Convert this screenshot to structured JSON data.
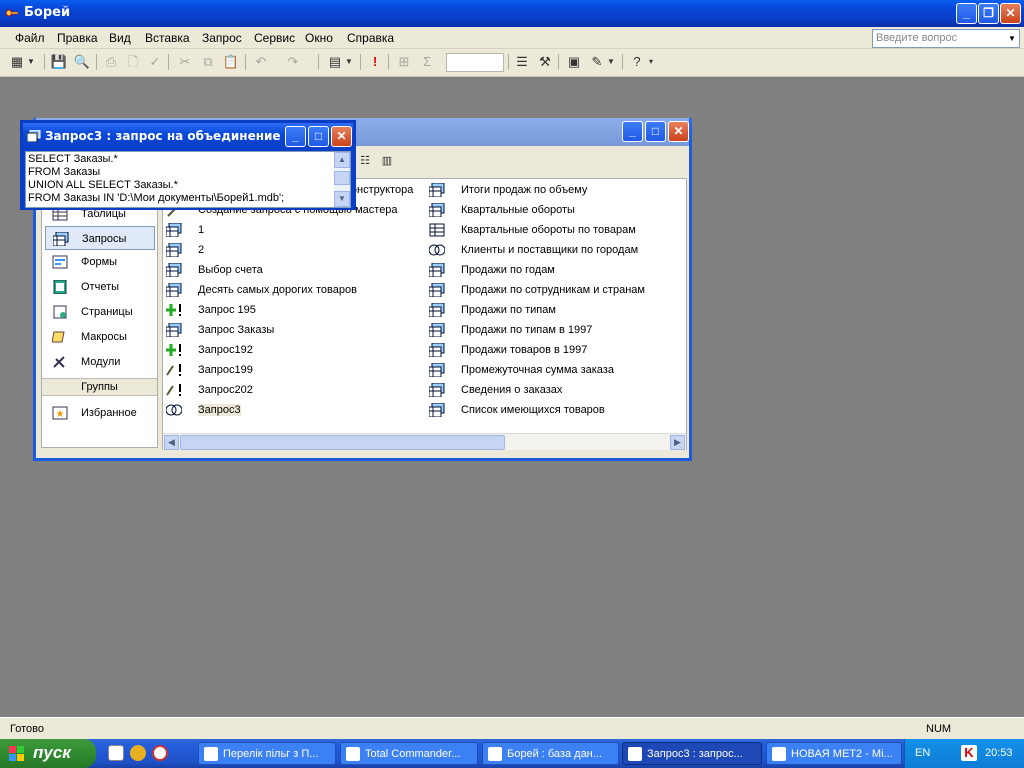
{
  "app": {
    "title": "Борей"
  },
  "menu": [
    "Файл",
    "Правка",
    "Вид",
    "Вставка",
    "Запрос",
    "Сервис",
    "Окно",
    "Справка"
  ],
  "ask_placeholder": "Введите вопрос",
  "db_window": {
    "nav": [
      "Таблицы",
      "Запросы",
      "Формы",
      "Отчеты",
      "Страницы",
      "Макросы",
      "Модули"
    ],
    "groups_header": "Группы",
    "groups": [
      "Избранное"
    ],
    "objects_col1": [
      "Создание запроса в режиме конструктора",
      "Создание запроса с помощью мастера",
      "1",
      "2",
      "Выбор счета",
      "Десять самых дорогих товаров",
      "Запрос 195",
      "Запрос Заказы",
      "Запрос192",
      "Запрос199",
      "Запрос202",
      "Запрос3"
    ],
    "objects_col2": [
      "Итоги продаж по объему",
      "Квартальные обороты",
      "Квартальные обороты по товарам",
      "Клиенты и поставщики по городам",
      "Продажи по годам",
      "Продажи по сотрудникам и странам",
      "Продажи по типам",
      "Продажи по типам в 1997",
      "Продажи товаров в 1997",
      "Промежуточная сумма заказа",
      "Сведения о заказах",
      "Список имеющихся товаров"
    ]
  },
  "query_window": {
    "title": "Запрос3 : запрос на объединение",
    "sql": [
      "SELECT Заказы.*",
      "FROM Заказы",
      "UNION ALL SELECT Заказы.*",
      "FROM Заказы IN 'D:\\Мои документы\\Борей1.mdb';"
    ]
  },
  "status": {
    "left": "Готово",
    "right": "NUM"
  },
  "taskbar": {
    "start": "пуск",
    "tasks": [
      "Перелік пільг з П...",
      "Total Commander...",
      "Борей : база дан...",
      "Запрос3 : запрос...",
      "НОВАЯ МЕТ2 - Mi..."
    ],
    "lang": "EN",
    "clock": "20:53"
  }
}
